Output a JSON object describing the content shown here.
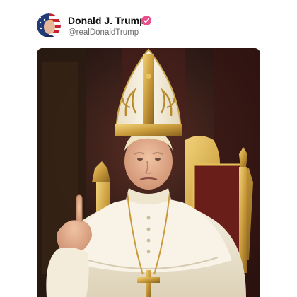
{
  "post": {
    "author_name": "Donald J. Trump",
    "author_handle": "@realDonaldTrump",
    "verified_badge_color": "#e8508c",
    "verified_badge_icon": "verified-badge-icon",
    "avatar_icon": "profile-avatar",
    "image_alt": "Image of Donald J. Trump dressed as the Pope in white papal robes and a gold-embroidered mitre, seated on a golden throne, raising his right index finger"
  }
}
